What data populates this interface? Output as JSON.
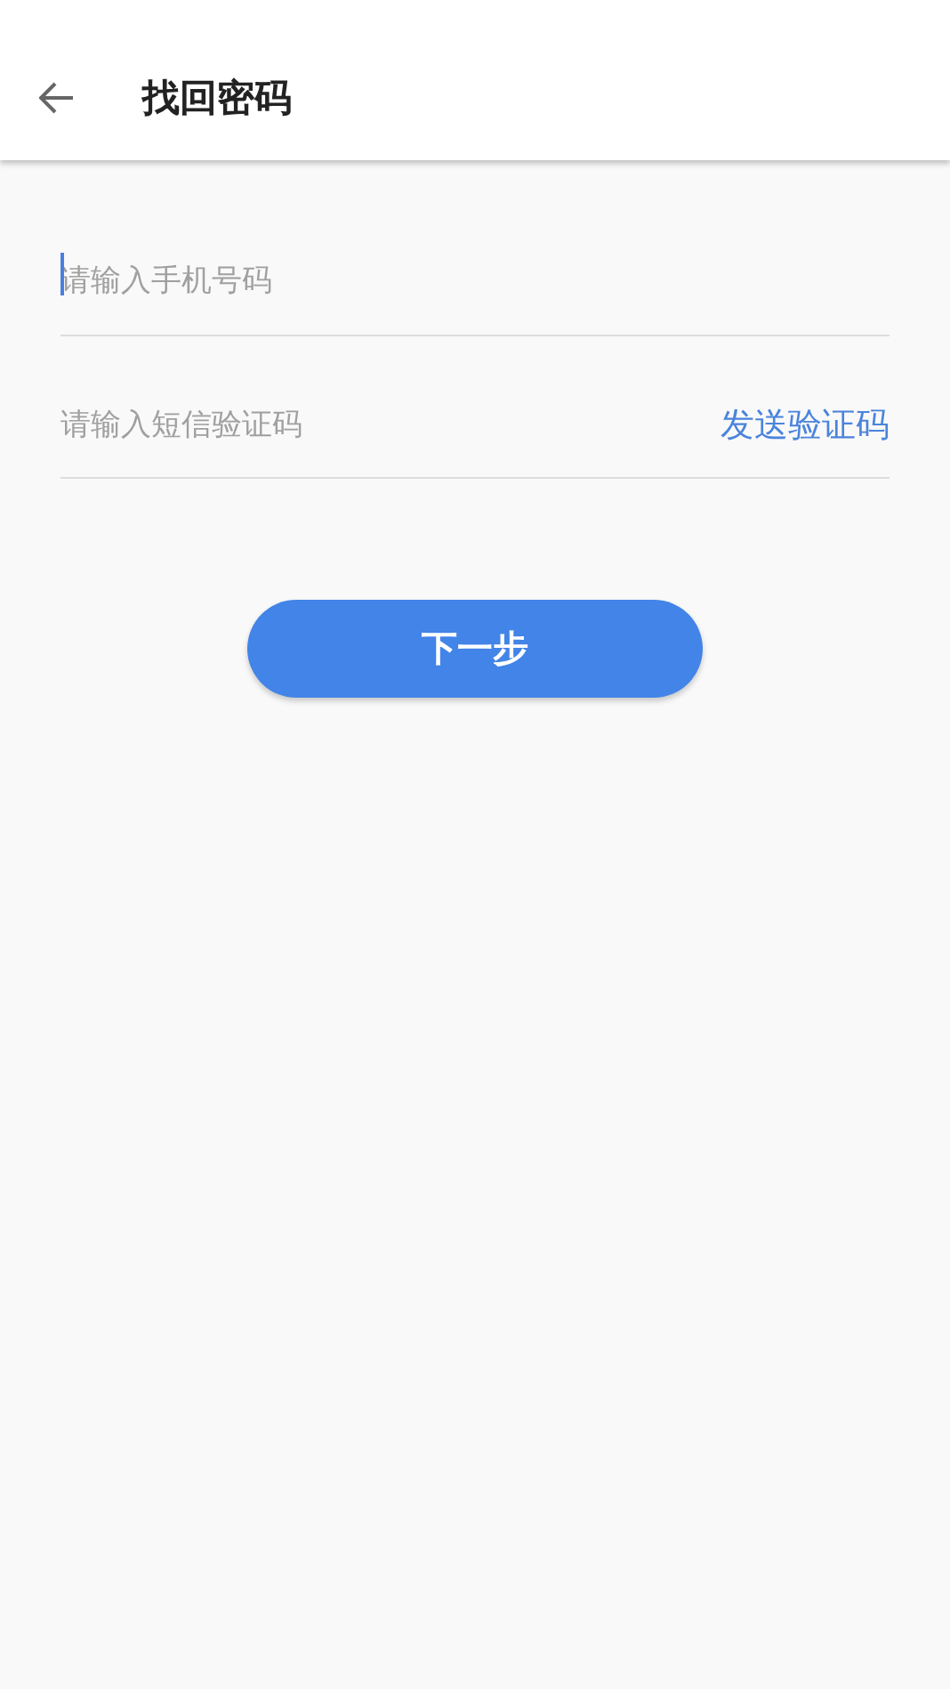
{
  "header": {
    "title": "找回密码"
  },
  "fields": [
    {
      "placeholder": "请输入手机号码",
      "focused": true
    },
    {
      "placeholder": "请输入短信验证码",
      "focused": false,
      "action": "发送验证码"
    }
  ],
  "next_button": "下一步"
}
